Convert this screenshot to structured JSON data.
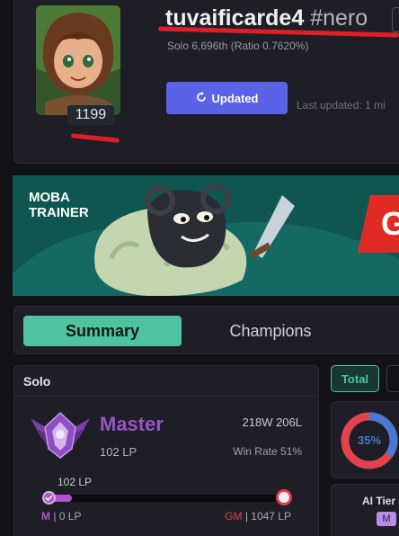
{
  "profile": {
    "username": "tuvaificarde4",
    "tag": "#nero",
    "rank_line": "Solo 6,696th (Ratio 0.7620%)",
    "level": "1199",
    "updated_button": "Updated",
    "last_updated": "Last updated: 1 mi"
  },
  "ad": {
    "brand_line1": "MOBA",
    "brand_line2": "TRAINER",
    "cta": "GO"
  },
  "tabs": {
    "summary": "Summary",
    "champions": "Champions"
  },
  "solo": {
    "title": "Solo",
    "tier": "Master",
    "lp": "102 LP",
    "wins_losses": "218W 206L",
    "win_rate": "Win Rate 51%",
    "progress_current": "102 LP",
    "progress_fraction": 0.1,
    "from_tier": "M",
    "from_lp": "0 LP",
    "to_tier": "GM",
    "to_lp": "1047 LP"
  },
  "stats": {
    "total_button": "Total",
    "donut_value": "35%",
    "donut_fraction": 0.35,
    "ai_tier_label": "AI Tier",
    "ai_tier_value": "M"
  },
  "colors": {
    "accent": "#4fc2a0",
    "master_purple": "#9a52c6",
    "updated_blue": "#5a62e6",
    "annotation_red": "#e01e28",
    "donut_blue": "#4a78d0",
    "donut_red": "#e0424e"
  }
}
